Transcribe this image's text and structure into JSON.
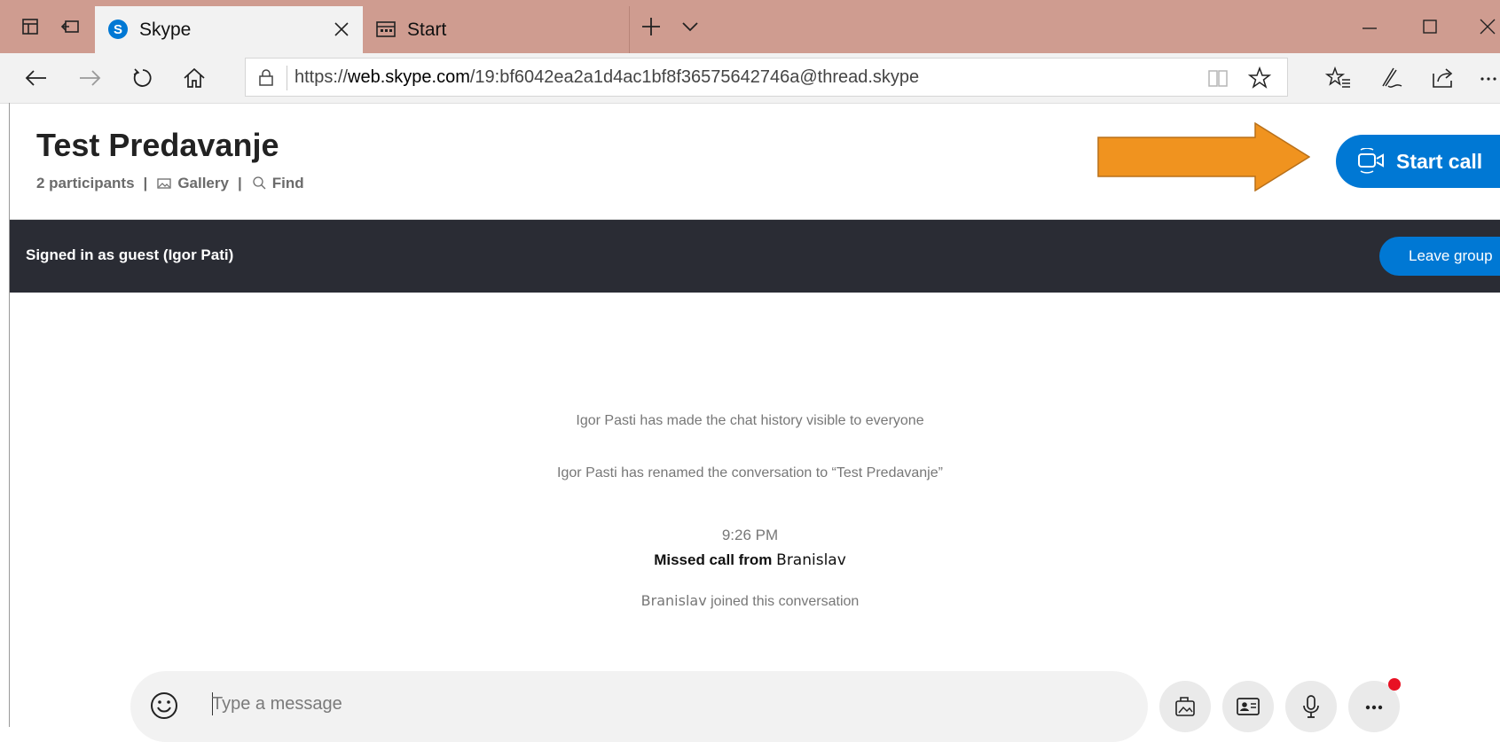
{
  "browser": {
    "tabs": [
      {
        "title": "Skype",
        "favicon": "skype-icon",
        "active": true
      },
      {
        "title": "Start",
        "favicon": "start-page-icon",
        "active": false
      }
    ],
    "url_scheme": "https://",
    "url_host": "web.skype.com",
    "url_path": "/19:bf6042ea2a1d4ac1bf8f36575642746a@thread.skype",
    "toolbar_icons": [
      "favorites-list-icon",
      "pen-icon",
      "share-icon",
      "more-icon"
    ]
  },
  "conversation": {
    "title": "Test Predavanje",
    "participants": "2 participants",
    "gallery": "Gallery",
    "find": "Find",
    "separator": "|",
    "start_call": "Start call"
  },
  "guest_bar": {
    "text": "Signed in as guest (Igor Pati)",
    "leave": "Leave group"
  },
  "messages": {
    "history_visible": "Igor Pasti has made the chat history visible to everyone",
    "renamed": "Igor Pasti has renamed the conversation to “Test Predavanje”",
    "timestamp": "9:26 PM",
    "missed_prefix": "Missed call from",
    "missed_name": "Branislav",
    "joined_name": "Branislav",
    "joined_suffix": "joined this conversation"
  },
  "composer": {
    "placeholder": "Type a message"
  },
  "colors": {
    "accent": "#0078d4",
    "tabbar": "#cf9c90",
    "guest_bar": "#2a2c34",
    "arrow": "#f0931f",
    "notification": "#e81123"
  }
}
